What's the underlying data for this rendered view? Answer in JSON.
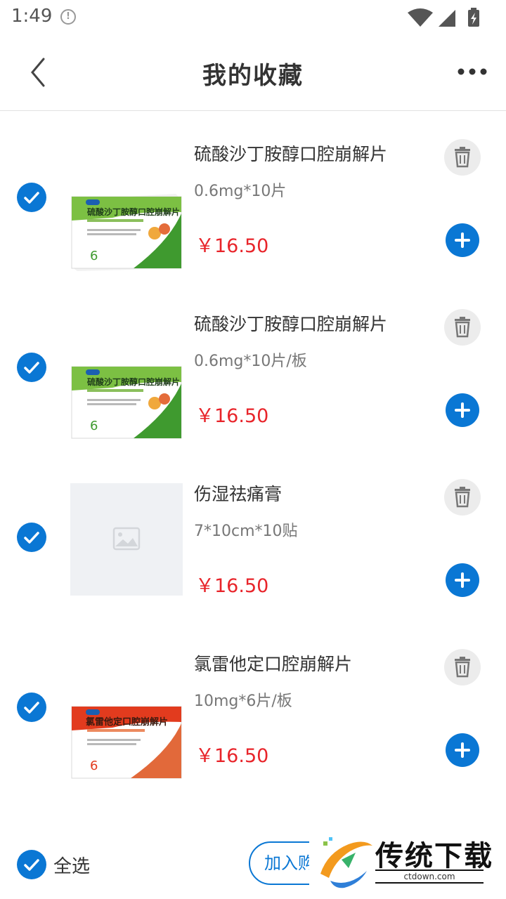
{
  "status_bar": {
    "time": "1:49",
    "info_icon": "info-circle-icon",
    "icons": [
      "wifi-icon",
      "signal-icon",
      "battery-charging-icon"
    ]
  },
  "header": {
    "title": "我的收藏",
    "back_icon": "chevron-left-icon",
    "more_icon": "more-horizontal-icon"
  },
  "items": [
    {
      "name": "硫酸沙丁胺醇口腔崩解片",
      "spec": "0.6mg*10片",
      "price": "￥16.50",
      "checked": true,
      "image": "green-medicine-box"
    },
    {
      "name": "硫酸沙丁胺醇口腔崩解片",
      "spec": "0.6mg*10片/板",
      "price": "￥16.50",
      "checked": true,
      "image": "green-medicine-box"
    },
    {
      "name": "伤湿祛痛膏",
      "spec": "7*10cm*10贴",
      "price": "￥16.50",
      "checked": true,
      "image": "placeholder-image"
    },
    {
      "name": "氯雷他定口腔崩解片",
      "spec": "10mg*6片/板",
      "price": "￥16.50",
      "checked": true,
      "image": "orange-medicine-box"
    }
  ],
  "footer": {
    "select_all_label": "全选",
    "select_all_checked": true,
    "add_to_cart_label": "加入购物车"
  },
  "watermark": {
    "text": "传统下载",
    "url": "ctdown.com"
  },
  "colors": {
    "accent": "#0a77d4",
    "price": "#e8242a",
    "divider": "#e2e2e2"
  }
}
